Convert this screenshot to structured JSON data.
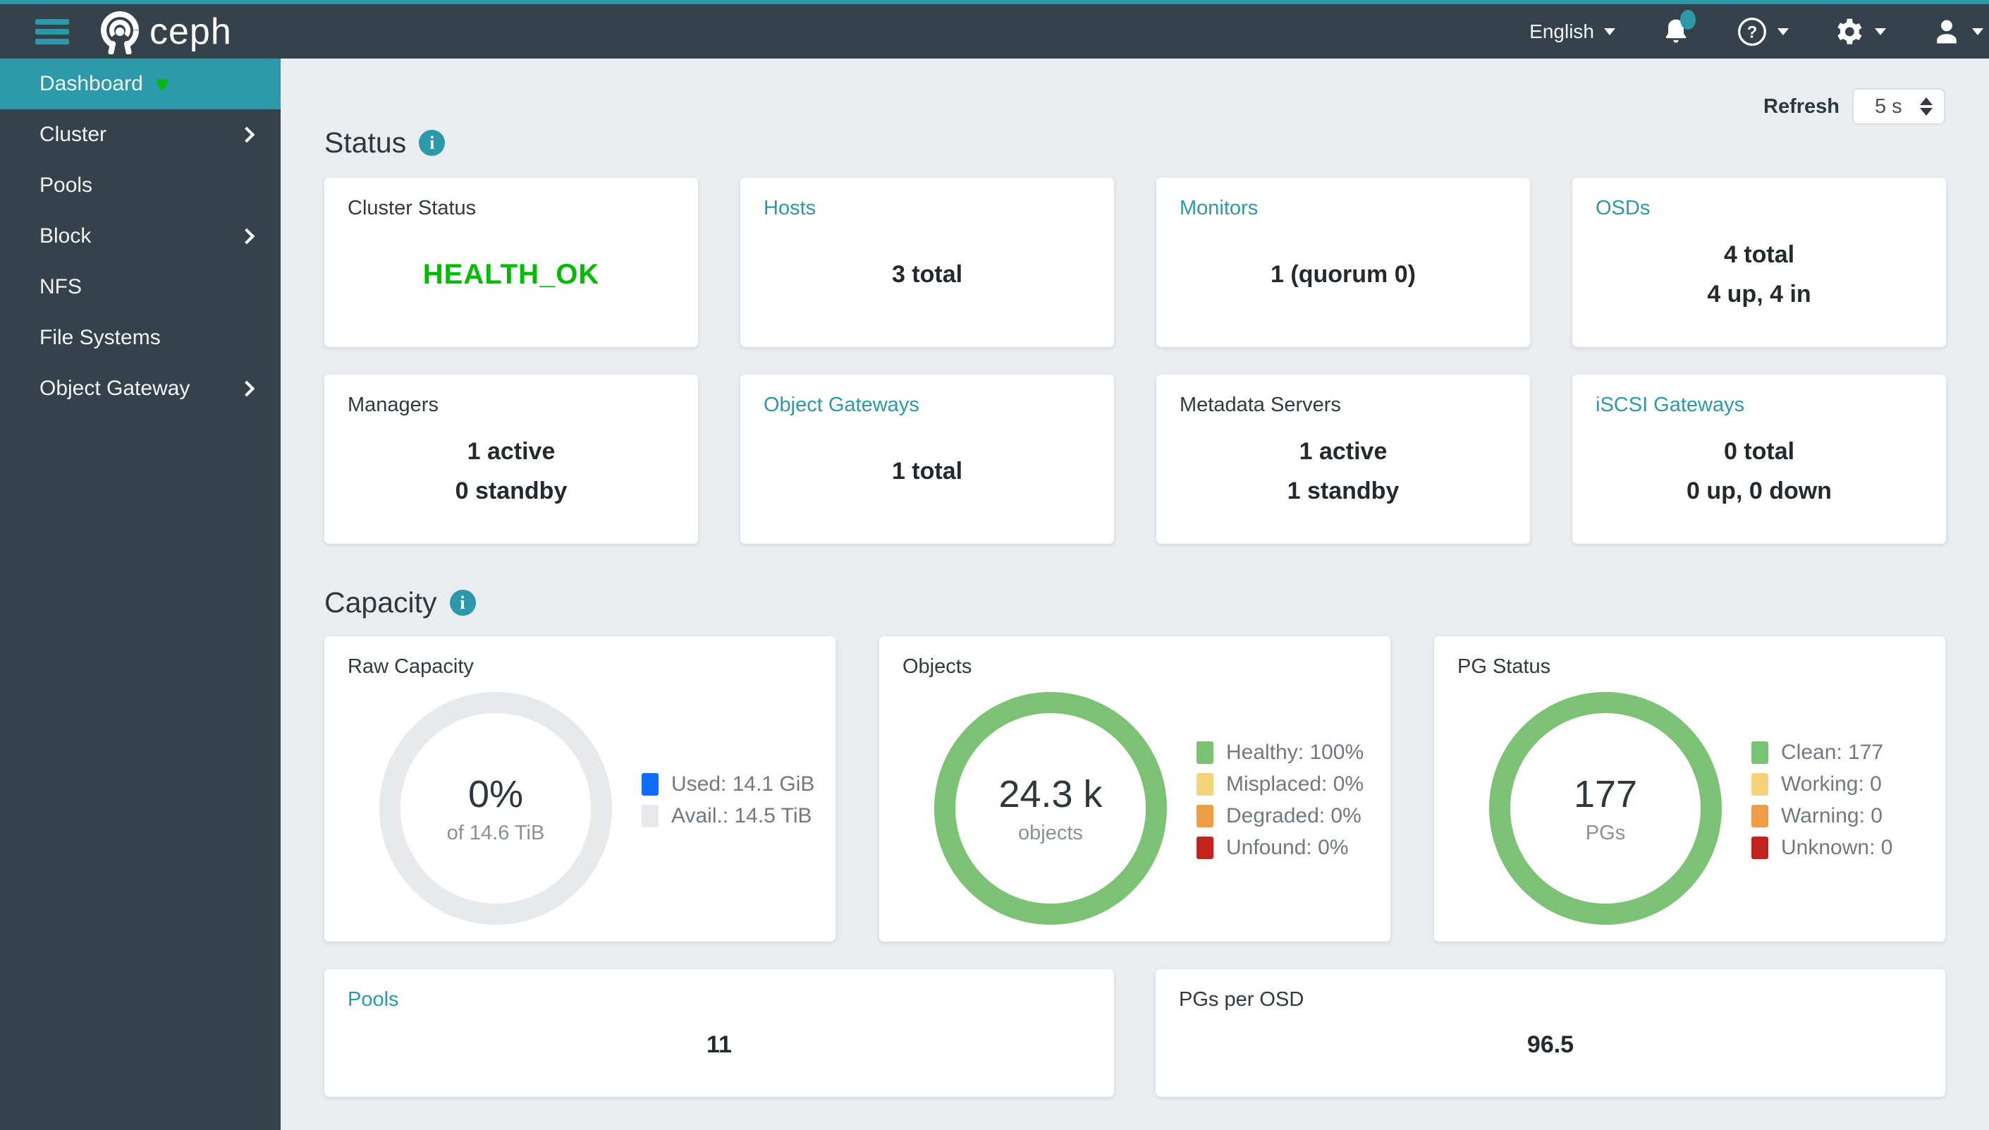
{
  "colors": {
    "accent_teal": "#2b99a8",
    "navbar_bg": "#36424b",
    "content_bg": "#e9edf0",
    "health_ok": "#00bb00",
    "used_blue": "#0d6efd",
    "avail_gray": "#e8e9ea",
    "healthy_green": "#7cc274",
    "working_yellow": "#f5d37a",
    "warning_orange": "#ee9d45",
    "error_red": "#c4231c"
  },
  "navbar": {
    "brand": "ceph",
    "language": "English",
    "icons": [
      "hamburger-icon",
      "bell-icon",
      "help-circle-icon",
      "gear-icon",
      "user-icon"
    ]
  },
  "sidebar": {
    "items": [
      {
        "label": "Dashboard",
        "active": true,
        "submenu": false
      },
      {
        "label": "Cluster",
        "active": false,
        "submenu": true
      },
      {
        "label": "Pools",
        "active": false,
        "submenu": false
      },
      {
        "label": "Block",
        "active": false,
        "submenu": true
      },
      {
        "label": "NFS",
        "active": false,
        "submenu": false
      },
      {
        "label": "File Systems",
        "active": false,
        "submenu": false
      },
      {
        "label": "Object Gateway",
        "active": false,
        "submenu": true
      }
    ]
  },
  "toolbar": {
    "refresh_label": "Refresh",
    "refresh_value": "5 s"
  },
  "sections": {
    "status": "Status",
    "capacity": "Capacity"
  },
  "status_cards": [
    {
      "title": "Cluster Status",
      "link": false,
      "health": "HEALTH_OK"
    },
    {
      "title": "Hosts",
      "link": true,
      "line1": "3 total"
    },
    {
      "title": "Monitors",
      "link": true,
      "line1": "1 (quorum 0)"
    },
    {
      "title": "OSDs",
      "link": true,
      "line1": "4 total",
      "line2": "4 up, 4 in"
    },
    {
      "title": "Managers",
      "link": false,
      "line1": "1 active",
      "line2": "0 standby"
    },
    {
      "title": "Object Gateways",
      "link": true,
      "line1": "1 total"
    },
    {
      "title": "Metadata Servers",
      "link": false,
      "line1": "1 active",
      "line2": "1 standby"
    },
    {
      "title": "iSCSI Gateways",
      "link": true,
      "line1": "0 total",
      "line2": "0 up, 0 down"
    }
  ],
  "capacity_cards": [
    {
      "title": "Raw Capacity",
      "chart": {
        "type": "donut",
        "center": "0%",
        "center_sub": "of 14.6 TiB",
        "ring_color": "#e8e9ea",
        "legend": [
          {
            "label": "Used: 14.1 GiB",
            "color": "#0d6efd"
          },
          {
            "label": "Avail.: 14.5 TiB",
            "color": "#e8e9ea"
          }
        ]
      }
    },
    {
      "title": "Objects",
      "chart": {
        "type": "donut",
        "center": "24.3 k",
        "center_sub": "objects",
        "ring_color": "#7cc274",
        "legend": [
          {
            "label": "Healthy: 100%",
            "color": "#7cc274"
          },
          {
            "label": "Misplaced: 0%",
            "color": "#f5d37a"
          },
          {
            "label": "Degraded: 0%",
            "color": "#ee9d45"
          },
          {
            "label": "Unfound: 0%",
            "color": "#c4231c"
          }
        ]
      }
    },
    {
      "title": "PG Status",
      "chart": {
        "type": "donut",
        "center": "177",
        "center_sub": "PGs",
        "ring_color": "#7cc274",
        "legend": [
          {
            "label": "Clean: 177",
            "color": "#7cc274"
          },
          {
            "label": "Working: 0",
            "color": "#f5d37a"
          },
          {
            "label": "Warning: 0",
            "color": "#ee9d45"
          },
          {
            "label": "Unknown: 0",
            "color": "#c4231c"
          }
        ]
      }
    }
  ],
  "bottom_cards": [
    {
      "title": "Pools",
      "link": true,
      "value": "11"
    },
    {
      "title": "PGs per OSD",
      "link": false,
      "value": "96.5"
    }
  ]
}
